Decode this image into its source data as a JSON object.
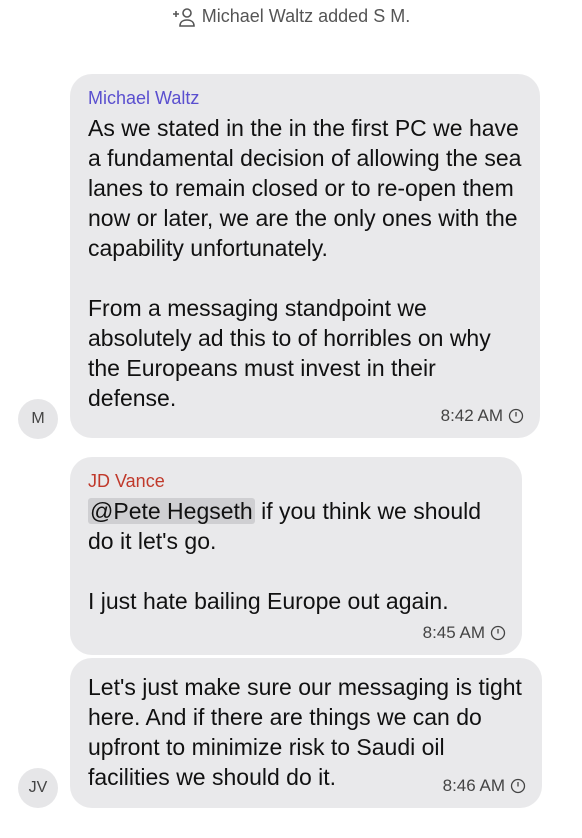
{
  "system": {
    "text": "Michael Waltz added S M.",
    "icon": "add-person-icon"
  },
  "messages": [
    {
      "avatar": "M",
      "sender": "Michael Waltz",
      "sender_color": "#5a4fcf",
      "paragraphs": [
        "As we stated in the in the first PC we have a fundamental decision of allowing the sea lanes to remain closed or to re-open them now or later, we are the only ones with the capability unfortunately.",
        "From a messaging standpoint we absolutely ad this to of horribles on why the Europeans must invest in their defense."
      ],
      "time": "8:42 AM"
    },
    {
      "sender": "JD Vance",
      "sender_color": "#c0392b",
      "mention": "@Pete Hegseth",
      "first_line_rest": " if you think we should do it let's go.",
      "second_paragraph": "I just hate bailing Europe out again.",
      "time": "8:45 AM"
    },
    {
      "avatar": "JV",
      "paragraph": "Let's just make sure our messaging is tight here. And if there are things we can do upfront to minimize risk to Saudi oil facilities we should do it.",
      "time": "8:46 AM"
    }
  ],
  "bubble_color": "#e9e9eb"
}
